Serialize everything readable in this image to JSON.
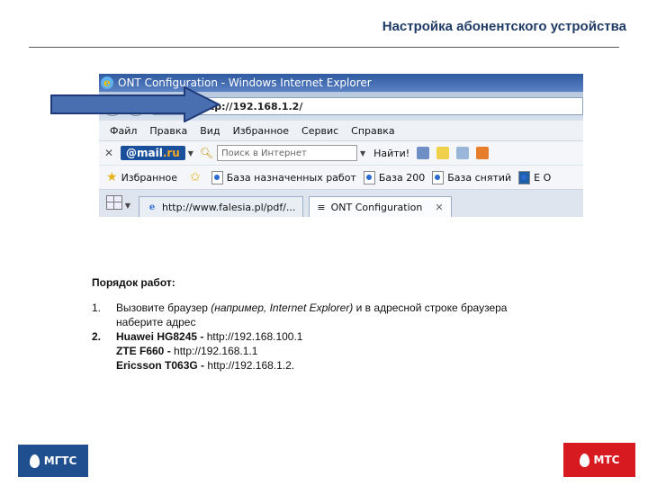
{
  "slide": {
    "title": "Настройка абонентского устройства"
  },
  "browser": {
    "window_title": "ONT Configuration - Windows Internet Explorer",
    "address": "tp://192.168.1.2/",
    "menu": [
      "Файл",
      "Правка",
      "Вид",
      "Избранное",
      "Сервис",
      "Справка"
    ],
    "toolbar": {
      "mailru_prefix": "@mail",
      "mailru_suffix": ".ru",
      "search_placeholder": "Поиск в Интернет",
      "find_label": "Найти!"
    },
    "favorites": {
      "label": "Избранное",
      "items": [
        "База назначенных работ",
        "База 200",
        "База снятий",
        "Е О"
      ]
    },
    "tabs": [
      {
        "label": "http://www.falesia.pl/pdf/..."
      },
      {
        "label": "ONT Configuration"
      }
    ]
  },
  "instructions": {
    "heading": "Порядок работ:",
    "step1_num": "1.",
    "step1_text_a": "Вызовите браузер ",
    "step1_text_b": "(например, Internet Explorer)",
    "step1_text_c": " и в адресной строке браузера",
    "step1_text_d": "наберите адрес",
    "step2_num": "2.",
    "devices": [
      {
        "name": "Huawei HG8245",
        "sep": " - ",
        "url": "http://192.168.100.1"
      },
      {
        "name": "ZTE F660",
        "sep": " - ",
        "url": "http://192.168.1.1"
      },
      {
        "name": "Ericsson T063G",
        "sep": " - ",
        "url": "http://192.168.1.2."
      }
    ]
  },
  "logos": {
    "left": "МГТС",
    "right": "МТС"
  },
  "colors": {
    "title": "#1f3b66",
    "arrow": "#4a6fb1",
    "mgts": "#1f4f8f",
    "mts": "#d71920"
  }
}
